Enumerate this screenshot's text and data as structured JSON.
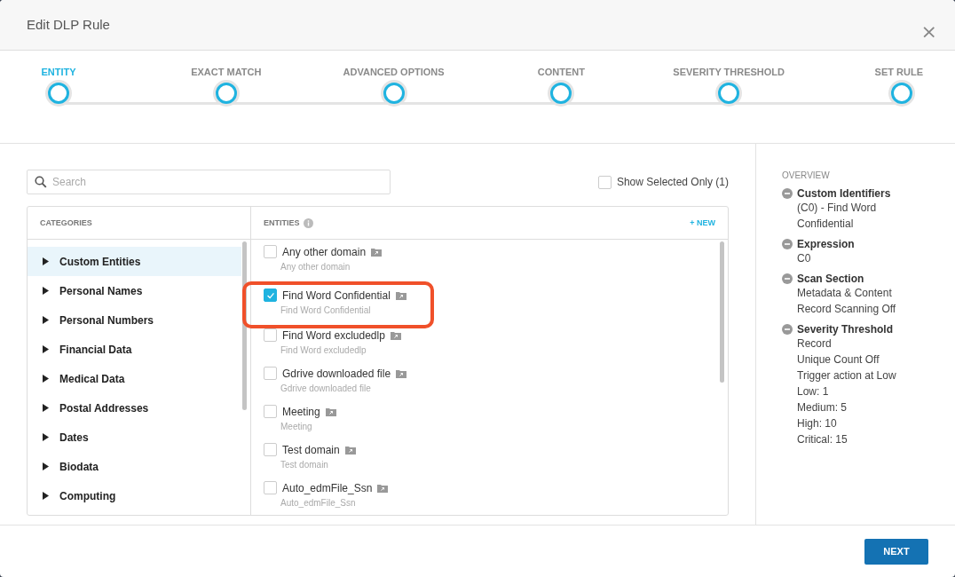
{
  "window": {
    "title": "Edit DLP Rule",
    "close": "×"
  },
  "steps": [
    {
      "label": "ENTITY",
      "selected": true
    },
    {
      "label": "EXACT MATCH",
      "selected": false
    },
    {
      "label": "ADVANCED OPTIONS",
      "selected": false
    },
    {
      "label": "CONTENT",
      "selected": false
    },
    {
      "label": "SEVERITY THRESHOLD",
      "selected": false
    },
    {
      "label": "SET RULE",
      "selected": false
    }
  ],
  "search": {
    "placeholder": "Search"
  },
  "show_selected": {
    "label": "Show Selected Only (1)",
    "checked": false
  },
  "categories": {
    "heading": "CATEGORIES",
    "items": [
      {
        "label": "Custom Entities",
        "selected": true
      },
      {
        "label": "Personal Names",
        "selected": false
      },
      {
        "label": "Personal Numbers",
        "selected": false
      },
      {
        "label": "Financial Data",
        "selected": false
      },
      {
        "label": "Medical Data",
        "selected": false
      },
      {
        "label": "Postal Addresses",
        "selected": false
      },
      {
        "label": "Dates",
        "selected": false
      },
      {
        "label": "Biodata",
        "selected": false
      },
      {
        "label": "Computing",
        "selected": false
      }
    ]
  },
  "entities": {
    "heading": "ENTITIES",
    "new": "+ NEW",
    "items": [
      {
        "title": "Any other domain",
        "subtitle": "Any other domain",
        "checked": false,
        "highlighted": false
      },
      {
        "title": "Find Word Confidential",
        "subtitle": "Find Word Confidential",
        "checked": true,
        "highlighted": true
      },
      {
        "title": "Find Word excludedlp",
        "subtitle": "Find Word excludedlp",
        "checked": false,
        "highlighted": false
      },
      {
        "title": "Gdrive downloaded file",
        "subtitle": "Gdrive downloaded file",
        "checked": false,
        "highlighted": false
      },
      {
        "title": "Meeting",
        "subtitle": "Meeting",
        "checked": false,
        "highlighted": false
      },
      {
        "title": "Test domain",
        "subtitle": "Test domain",
        "checked": false,
        "highlighted": false
      },
      {
        "title": "Auto_edmFile_Ssn",
        "subtitle": "Auto_edmFile_Ssn",
        "checked": false,
        "highlighted": false
      }
    ]
  },
  "overview": {
    "heading": "OVERVIEW",
    "sections": [
      {
        "title": "Custom Identifiers",
        "lines": [
          "(C0) - Find Word Confidential"
        ]
      },
      {
        "title": "Expression",
        "lines": [
          "C0"
        ]
      },
      {
        "title": "Scan Section",
        "lines": [
          "Metadata & Content",
          "Record Scanning Off"
        ]
      },
      {
        "title": "Severity Threshold",
        "lines": [
          "Record",
          "Unique Count Off",
          "Trigger action at Low",
          "Low: 1",
          "Medium: 5",
          "High: 10",
          "Critical: 15"
        ]
      }
    ]
  },
  "buttons": [
    "NEXT"
  ]
}
